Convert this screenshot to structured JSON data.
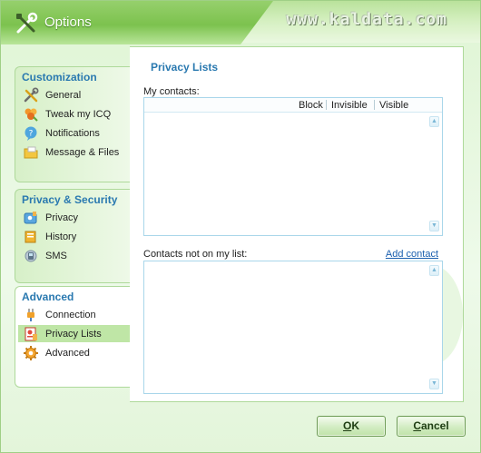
{
  "window": {
    "title": "Options",
    "watermark": "www.kaldata.com"
  },
  "nav": {
    "groups": [
      {
        "title": "Customization",
        "items": [
          {
            "label": "General",
            "icon": "tools-icon"
          },
          {
            "label": "Tweak my ICQ",
            "icon": "flower-icon"
          },
          {
            "label": "Notifications",
            "icon": "notification-bubble-icon"
          },
          {
            "label": "Message & Files",
            "icon": "folder-message-icon"
          }
        ]
      },
      {
        "title": "Privacy & Security",
        "items": [
          {
            "label": "Privacy",
            "icon": "privacy-card-icon"
          },
          {
            "label": "History",
            "icon": "history-book-icon"
          },
          {
            "label": "SMS",
            "icon": "sms-phone-icon"
          }
        ]
      },
      {
        "title": "Advanced",
        "items": [
          {
            "label": "Connection",
            "icon": "plug-icon"
          },
          {
            "label": "Privacy Lists",
            "icon": "privacy-list-icon",
            "selected": true
          },
          {
            "label": "Advanced",
            "icon": "gear-icon"
          }
        ]
      }
    ]
  },
  "panel": {
    "title": "Privacy Lists",
    "my_contacts_label": "My contacts:",
    "columns": [
      "Block",
      "Invisible",
      "Visible"
    ],
    "not_on_list_label": "Contacts not on my list:",
    "add_contact": "Add contact"
  },
  "buttons": {
    "ok_rest": "K",
    "ok_mnemonic": "O",
    "cancel_mnemonic": "C",
    "cancel_rest": "ancel"
  },
  "colors": {
    "accent_title": "#2a79b0",
    "frame_green": "#7cc24e",
    "selected_bg": "#bfe6a6"
  }
}
